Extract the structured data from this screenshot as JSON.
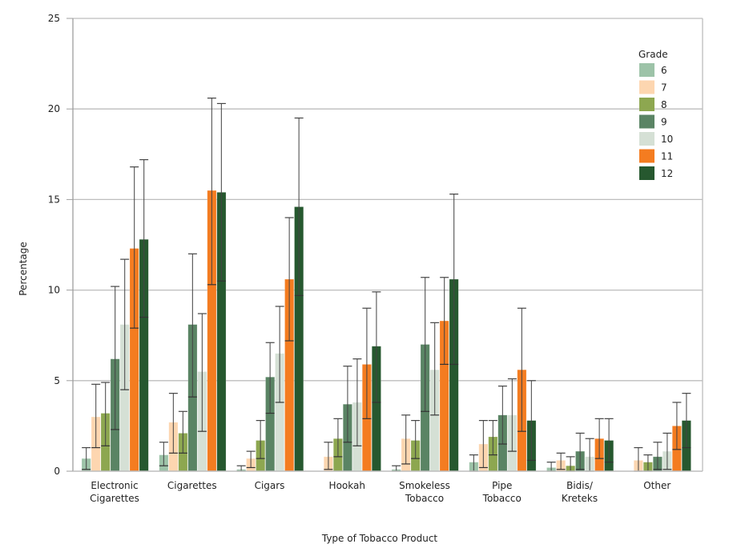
{
  "chart_data": {
    "type": "bar",
    "title": "",
    "xlabel": "Type of Tobacco Product",
    "ylabel": "Percentage",
    "ylim": [
      0,
      25
    ],
    "yticks": [
      0,
      5,
      10,
      15,
      20,
      25
    ],
    "grid": true,
    "legend_title": "Grade",
    "legend_position": "top-right",
    "categories": [
      [
        "Electronic",
        "Cigarettes"
      ],
      [
        "Cigarettes"
      ],
      [
        "Cigars"
      ],
      [
        "Hookah"
      ],
      [
        "Smokeless",
        "Tobacco"
      ],
      [
        "Pipe",
        "Tobacco"
      ],
      [
        "Bidis/",
        "Kreteks"
      ],
      [
        "Other"
      ]
    ],
    "series": [
      {
        "name": "6",
        "color": "#9dc3a8",
        "values": [
          0.7,
          0.9,
          0.1,
          null,
          0.1,
          0.5,
          0.2,
          null
        ],
        "err_low": [
          0.1,
          0.3,
          0.0,
          null,
          0.0,
          0.0,
          0.0,
          null
        ],
        "err_high": [
          1.3,
          1.6,
          0.3,
          null,
          0.3,
          0.9,
          0.5,
          null
        ]
      },
      {
        "name": "7",
        "color": "#fdd6b0",
        "values": [
          3.0,
          2.7,
          0.7,
          0.8,
          1.8,
          1.5,
          0.6,
          0.6
        ],
        "err_low": [
          1.3,
          1.0,
          0.2,
          0.1,
          0.4,
          0.2,
          0.1,
          0.0
        ],
        "err_high": [
          4.8,
          4.3,
          1.1,
          1.6,
          3.1,
          2.8,
          1.0,
          1.3
        ]
      },
      {
        "name": "8",
        "color": "#8da750",
        "values": [
          3.2,
          2.1,
          1.7,
          1.8,
          1.7,
          1.9,
          0.3,
          0.5
        ],
        "err_low": [
          1.4,
          1.0,
          0.7,
          0.8,
          0.7,
          0.9,
          0.0,
          0.0
        ],
        "err_high": [
          4.9,
          3.3,
          2.8,
          2.9,
          2.8,
          2.8,
          0.8,
          0.9
        ]
      },
      {
        "name": "9",
        "color": "#5a8464",
        "values": [
          6.2,
          8.1,
          5.2,
          3.7,
          7.0,
          3.1,
          1.1,
          0.8
        ],
        "err_low": [
          2.3,
          4.1,
          3.2,
          1.6,
          3.3,
          1.5,
          0.1,
          0.1
        ],
        "err_high": [
          10.2,
          12.0,
          7.1,
          5.8,
          10.7,
          4.7,
          2.1,
          1.6
        ]
      },
      {
        "name": "10",
        "color": "#d5e0d5",
        "values": [
          8.1,
          5.5,
          6.5,
          3.8,
          5.6,
          3.1,
          0.8,
          1.1
        ],
        "err_low": [
          4.5,
          2.2,
          3.8,
          1.4,
          3.1,
          1.1,
          0.0,
          0.1
        ],
        "err_high": [
          11.7,
          8.7,
          9.1,
          6.2,
          8.2,
          5.1,
          1.8,
          2.1
        ]
      },
      {
        "name": "11",
        "color": "#f47c20",
        "values": [
          12.3,
          15.5,
          10.6,
          5.9,
          8.3,
          5.6,
          1.8,
          2.5
        ],
        "err_low": [
          7.9,
          10.3,
          7.2,
          2.9,
          5.9,
          2.2,
          0.7,
          1.2
        ],
        "err_high": [
          16.8,
          20.6,
          14.0,
          9.0,
          10.7,
          9.0,
          2.9,
          3.8
        ]
      },
      {
        "name": "12",
        "color": "#26582f",
        "values": [
          12.8,
          15.4,
          14.6,
          6.9,
          10.6,
          2.8,
          1.7,
          2.8
        ],
        "err_low": [
          8.5,
          10.5,
          9.7,
          3.8,
          5.9,
          0.6,
          0.5,
          1.3
        ],
        "err_high": [
          17.2,
          20.3,
          19.5,
          9.9,
          15.3,
          5.0,
          2.9,
          4.3
        ]
      }
    ]
  }
}
